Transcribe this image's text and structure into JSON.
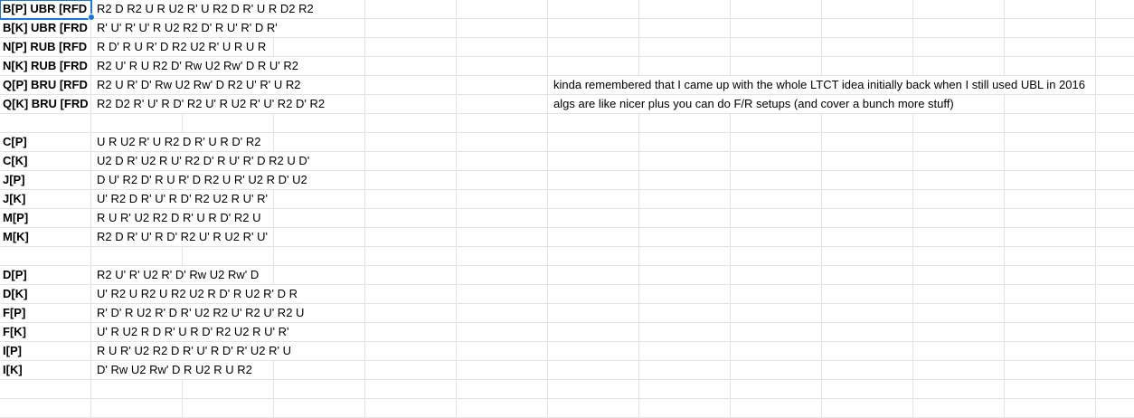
{
  "rows": [
    {
      "label": "B[P] UBR [RFD",
      "alg": "R2 D R2 U R U2 R' U R2 D R' U R D2 R2",
      "note": ""
    },
    {
      "label": "B[K] UBR [FRD",
      "alg": "R' U' R' U' R U2 R2 D' R U' R' D R'",
      "note": ""
    },
    {
      "label": "N[P] RUB [RFD",
      "alg": "R D' R U R' D R2 U2 R' U R U R",
      "note": ""
    },
    {
      "label": "N[K] RUB [FRD",
      "alg": "R2 U' R U R2 D' Rw U2 Rw' D R U' R2",
      "note": ""
    },
    {
      "label": "Q[P] BRU [RFD",
      "alg": "R2 U R' D' Rw U2 Rw' D R2 U' R' U R2",
      "note": "kinda remembered that I came up with the whole LTCT idea initially back when I still used UBL in 2016"
    },
    {
      "label": "Q[K] BRU [FRD",
      "alg": "R2 D2 R' U' R D' R2 U' R U2 R' U' R2 D' R2",
      "note": "algs are like nicer plus you can do F/R setups (and cover a bunch more stuff)"
    },
    {
      "label": "",
      "alg": "",
      "note": ""
    },
    {
      "label": "C[P]",
      "alg": "U R U2 R' U R2 D R' U R D' R2",
      "note": ""
    },
    {
      "label": "C[K]",
      "alg": "U2 D R' U2 R U' R2 D' R U' R' D R2 U D'",
      "note": ""
    },
    {
      "label": "J[P]",
      "alg": "D U' R2 D' R U R' D R2 U R' U2 R D' U2",
      "note": ""
    },
    {
      "label": "J[K]",
      "alg": "U' R2 D R' U' R D' R2 U2 R U' R'",
      "note": ""
    },
    {
      "label": "M[P]",
      "alg": "R U R' U2 R2 D R' U R D' R2 U",
      "note": ""
    },
    {
      "label": "M[K]",
      "alg": "R2 D R' U' R D' R2 U' R U2 R' U'",
      "note": ""
    },
    {
      "label": "",
      "alg": "",
      "note": ""
    },
    {
      "label": "D[P]",
      "alg": "R2 U' R' U2 R' D' Rw U2 Rw' D",
      "note": ""
    },
    {
      "label": "D[K]",
      "alg": "U' R2 U R2 U R2 U2 R D' R U2 R' D R",
      "note": ""
    },
    {
      "label": "F[P]",
      "alg": "R' D' R U2 R' D R' U2 R2 U' R2 U' R2 U",
      "note": ""
    },
    {
      "label": "F[K]",
      "alg": "U' R U2 R D R' U R D' R2 U2 R U' R'",
      "note": ""
    },
    {
      "label": "I[P]",
      "alg": "R U R' U2 R2 D R' U' R D' R' U2 R' U",
      "note": ""
    },
    {
      "label": "I[K]",
      "alg": "D' Rw U2 Rw' D R U2 R U R2",
      "note": ""
    },
    {
      "label": "",
      "alg": "",
      "note": ""
    },
    {
      "label": "",
      "alg": "",
      "note": ""
    }
  ]
}
